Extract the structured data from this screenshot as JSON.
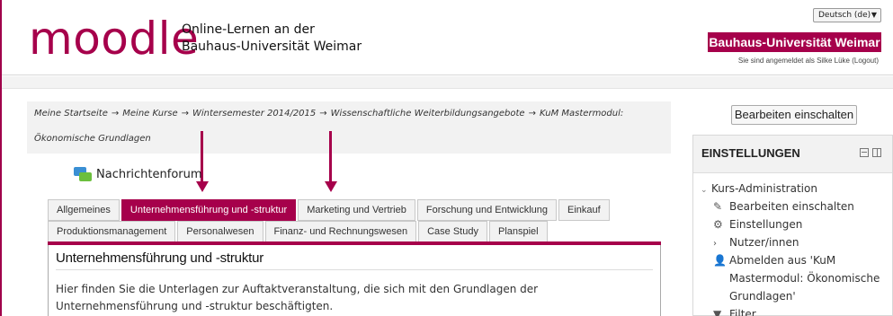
{
  "header": {
    "logo": "moodle",
    "site_title_line1": "Online-Lernen an der",
    "site_title_line2": "Bauhaus-Universität Weimar",
    "language": "Deutsch (de)",
    "language_arrow": "▼",
    "university": "Bauhaus-Universität Weimar",
    "login_info": "Sie sind angemeldet als Silke Lüke (Logout)"
  },
  "breadcrumb": {
    "items": [
      "Meine Startseite",
      "Meine Kurse",
      "Wintersemester 2014/2015",
      "Wissenschaftliche Weiterbildungsangebote",
      "KuM Mastermodul:",
      "Ökonomische Grundlagen"
    ],
    "separator": "→"
  },
  "forum": {
    "label": "Nachrichtenforum",
    "icon": "forum-icon"
  },
  "tabs": {
    "row1": [
      "Allgemeines",
      "Unternehmensführung und -struktur",
      "Marketing und Vertrieb",
      "Forschung und Entwicklung",
      "Einkauf"
    ],
    "row2": [
      "Produktionsmanagement",
      "Personalwesen",
      "Finanz- und Rechnungswesen",
      "Case Study",
      "Planspiel"
    ],
    "active": "Unternehmensführung und -struktur"
  },
  "section": {
    "title": "Unternehmensführung und -struktur",
    "text": "Hier finden Sie die Unterlagen zur Auftaktveranstaltung, die sich mit den Grundlagen der Unternehmensführung und -struktur beschäftigten."
  },
  "right": {
    "edit_button": "Bearbeiten einschalten",
    "block_title": "EINSTELLUNGEN",
    "admin_label": "Kurs-Administration",
    "items": {
      "edit": "Bearbeiten einschalten",
      "settings": "Einstellungen",
      "users": "Nutzer/innen",
      "unenrol_1": "Abmelden aus 'KuM",
      "unenrol_2": "Mastermodul: Ökonomische",
      "unenrol_3": "Grundlagen'",
      "filter": "Filter"
    }
  },
  "colors": {
    "brand": "#a6004b",
    "panel": "#f2f2f2"
  }
}
